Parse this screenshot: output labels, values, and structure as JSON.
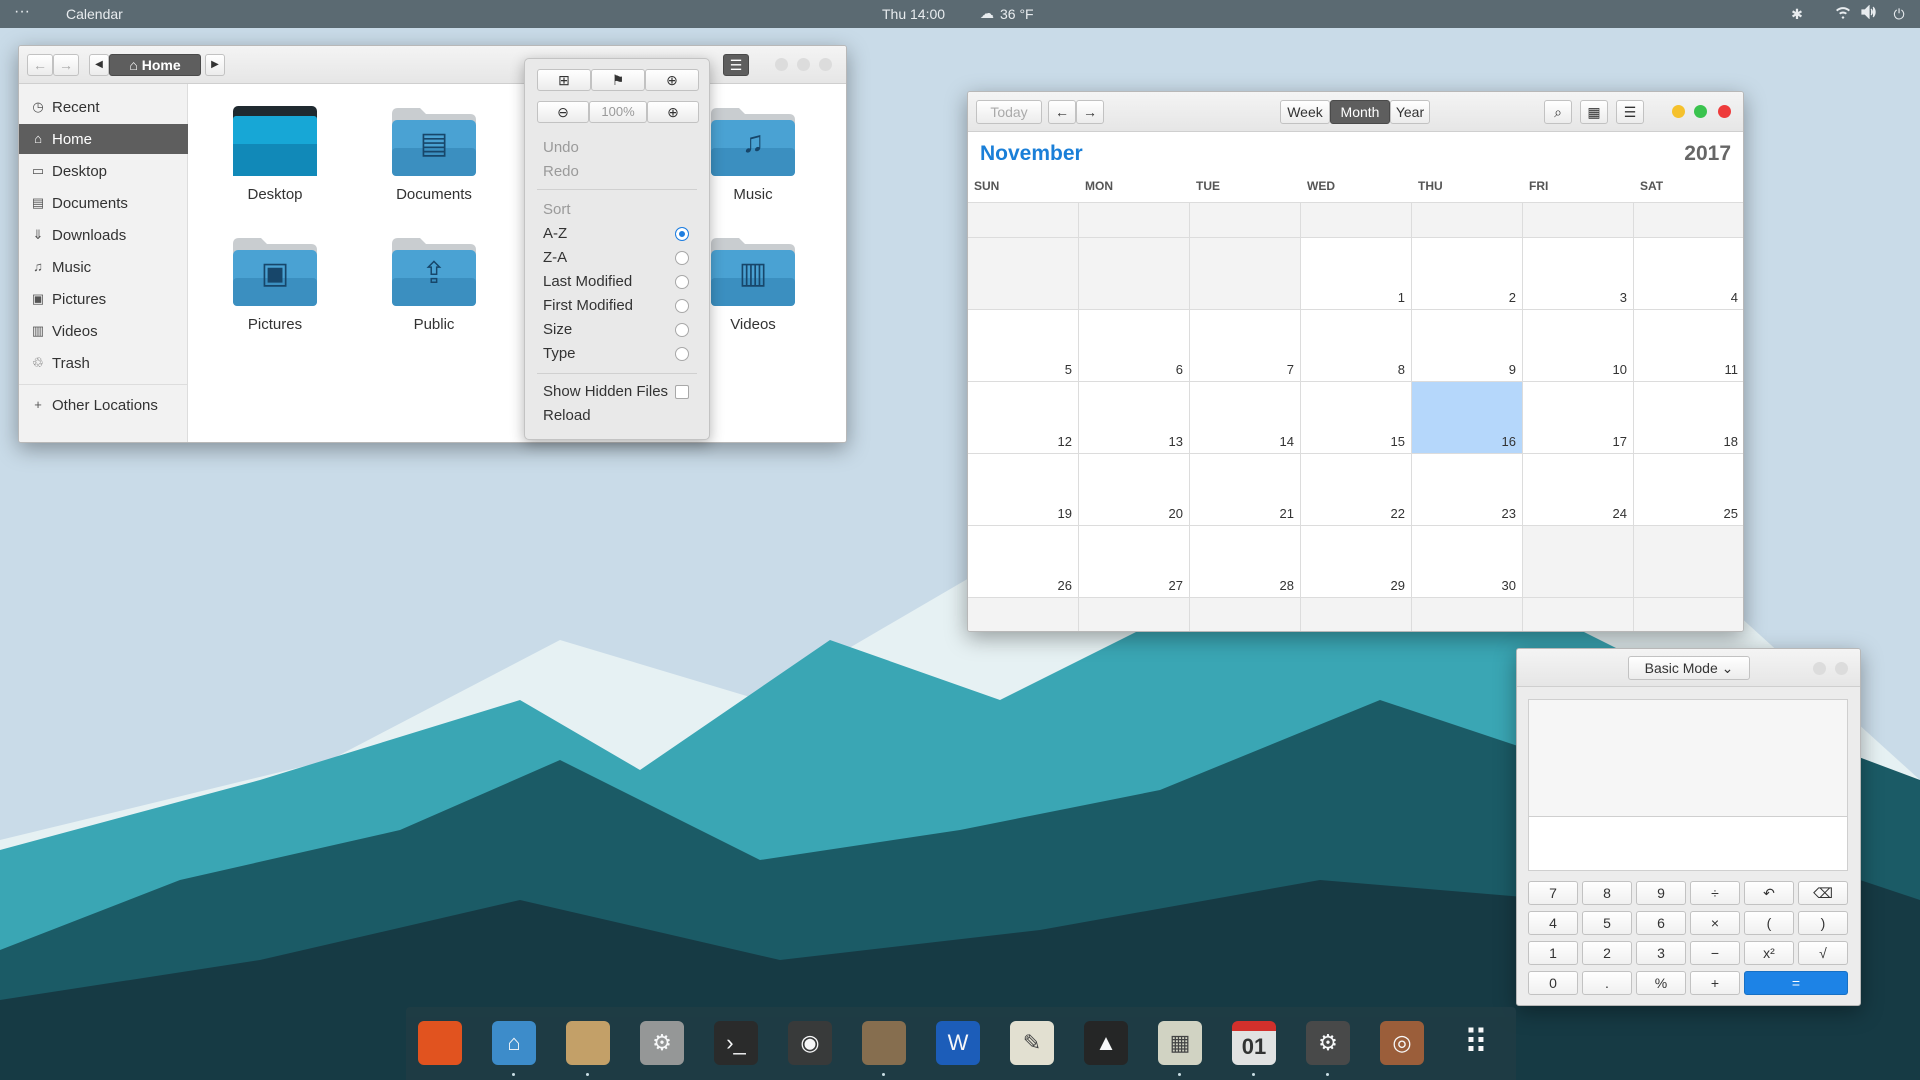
{
  "topbar": {
    "menu": "···",
    "app_name": "Calendar",
    "clock": "Thu 14:00",
    "weather": "36 °F",
    "icons": [
      "weather-cloud-icon",
      "accessibility-icon",
      "wifi-icon",
      "volume-icon",
      "power-icon"
    ]
  },
  "files": {
    "path": "Home",
    "sidebar": [
      {
        "label": "Recent",
        "icon": "clock-icon"
      },
      {
        "label": "Home",
        "icon": "home-icon",
        "selected": true
      },
      {
        "label": "Desktop",
        "icon": "desktop-icon"
      },
      {
        "label": "Documents",
        "icon": "document-icon"
      },
      {
        "label": "Downloads",
        "icon": "download-icon"
      },
      {
        "label": "Music",
        "icon": "music-icon"
      },
      {
        "label": "Pictures",
        "icon": "picture-icon"
      },
      {
        "label": "Videos",
        "icon": "film-icon"
      },
      {
        "label": "Trash",
        "icon": "trash-icon"
      },
      {
        "label": "Other Locations",
        "icon": "plus-icon"
      }
    ],
    "folders": [
      "Desktop",
      "Documents",
      "Music",
      "Pictures",
      "Public",
      "Videos"
    ]
  },
  "popover": {
    "zoom": "100%",
    "undo": "Undo",
    "redo": "Redo",
    "sort_header": "Sort",
    "sort_options": [
      {
        "label": "A-Z",
        "selected": true
      },
      {
        "label": "Z-A"
      },
      {
        "label": "Last Modified"
      },
      {
        "label": "First Modified"
      },
      {
        "label": "Size"
      },
      {
        "label": "Type"
      }
    ],
    "show_hidden": "Show Hidden Files",
    "reload": "Reload"
  },
  "calendar": {
    "today_button": "Today",
    "views": [
      "Week",
      "Month",
      "Year"
    ],
    "active_view": "Month",
    "month": "November",
    "year": "2017",
    "weekdays": [
      "SUN",
      "MON",
      "TUE",
      "WED",
      "THU",
      "FRI",
      "SAT"
    ],
    "days": [
      "",
      "",
      "",
      "",
      "",
      "",
      "",
      "",
      "",
      "",
      "1",
      "2",
      "3",
      "4",
      "5",
      "6",
      "7",
      "8",
      "9",
      "10",
      "11",
      "12",
      "13",
      "14",
      "15",
      "16",
      "17",
      "18",
      "19",
      "20",
      "21",
      "22",
      "23",
      "24",
      "25",
      "26",
      "27",
      "28",
      "29",
      "30",
      "",
      ""
    ],
    "today": "16",
    "accent": "#1a7fd8"
  },
  "calculator": {
    "mode": "Basic Mode",
    "keys": [
      [
        "7",
        "8",
        "9",
        "÷",
        "↶",
        "⌫"
      ],
      [
        "4",
        "5",
        "6",
        "×",
        "(",
        ")"
      ],
      [
        "1",
        "2",
        "3",
        "−",
        "x²",
        "√"
      ],
      [
        "0",
        ".",
        "%",
        "+",
        "="
      ]
    ],
    "equals_color": "#1d83e6"
  },
  "dock": {
    "apps": [
      {
        "name": "firefox-icon",
        "glyph": "",
        "bg": "#e8541e"
      },
      {
        "name": "files-icon",
        "glyph": "⌂",
        "bg": "#3f8fcf"
      },
      {
        "name": "archive-manager-icon",
        "glyph": "",
        "bg": "#c9a46a"
      },
      {
        "name": "settings-icon",
        "glyph": "⚙",
        "bg": "#9a9a9a"
      },
      {
        "name": "terminal-icon",
        "glyph": "›_",
        "bg": "#2b2b2b"
      },
      {
        "name": "camera-icon",
        "glyph": "◉",
        "bg": "#3a3a3a"
      },
      {
        "name": "gimp-icon",
        "glyph": "",
        "bg": "#8a7050"
      },
      {
        "name": "word-processor-icon",
        "glyph": "W",
        "bg": "#1d5fbd"
      },
      {
        "name": "text-editor-icon",
        "glyph": "✎",
        "bg": "#e9e6d6"
      },
      {
        "name": "vlc-icon",
        "glyph": "▲",
        "bg": "#262626"
      },
      {
        "name": "calculator-icon",
        "glyph": "▦",
        "bg": "#d8d8c8"
      },
      {
        "name": "calendar-icon",
        "glyph": "01",
        "bg": "#e8e8e8"
      },
      {
        "name": "system-monitor-icon",
        "glyph": "⚙",
        "bg": "#4a4a4a"
      },
      {
        "name": "speaker-icon",
        "glyph": "◎",
        "bg": "#a0603a"
      },
      {
        "name": "app-grid-icon",
        "glyph": "⠿",
        "bg": "transparent"
      }
    ]
  }
}
